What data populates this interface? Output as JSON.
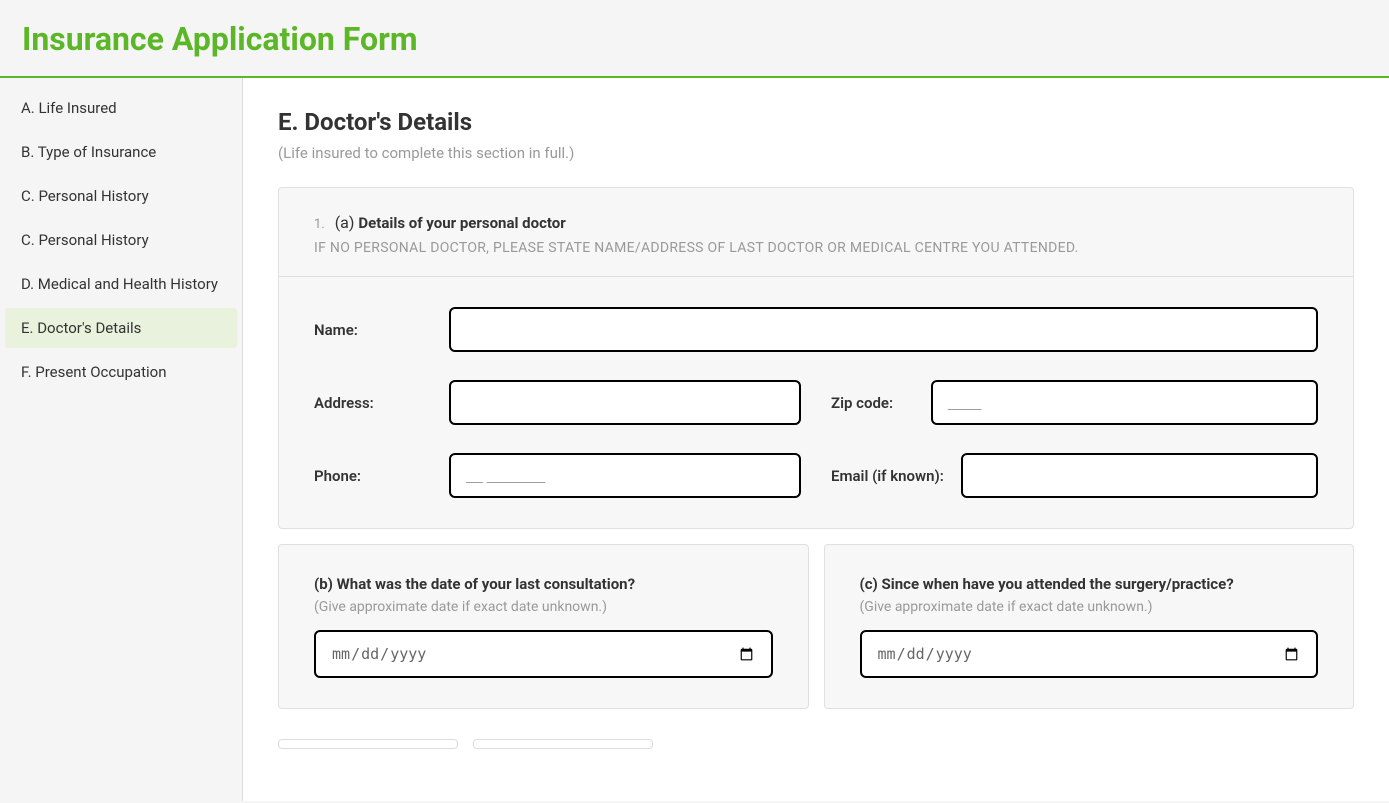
{
  "header": {
    "title": "Insurance Application Form"
  },
  "sidebar": {
    "items": [
      {
        "label": "A. Life Insured",
        "active": false
      },
      {
        "label": "B. Type of Insurance",
        "active": false
      },
      {
        "label": "C. Personal History",
        "active": false
      },
      {
        "label": "C. Personal History",
        "active": false
      },
      {
        "label": "D. Medical and Health History",
        "active": false
      },
      {
        "label": "E. Doctor's Details",
        "active": true
      },
      {
        "label": "F. Present Occupation",
        "active": false
      }
    ]
  },
  "main": {
    "section_title": "E. Doctor's Details",
    "section_subtitle": "(Life insured to complete this section in full.)",
    "q1": {
      "number": "1.",
      "prefix": "(a) ",
      "title": "Details of your personal doctor",
      "sub": "IF NO PERSONAL DOCTOR, PLEASE STATE NAME/ADDRESS OF LAST DOCTOR OR MEDICAL CENTRE YOU ATTENDED.",
      "fields": {
        "name_label": "Name:",
        "name_value": "",
        "address_label": "Address:",
        "address_value": "",
        "zip_label": "Zip code:",
        "zip_placeholder": "____",
        "zip_value": "",
        "phone_label": "Phone:",
        "phone_placeholder": "__ _______",
        "phone_value": "",
        "email_label": "Email (if known):",
        "email_value": ""
      }
    },
    "qb": {
      "title": "(b) What was the date of your last consultation?",
      "sub": "(Give approximate date if exact date unknown.)",
      "placeholder": "mm/dd/yyyy",
      "value": ""
    },
    "qc": {
      "title": "(c) Since when have you attended the surgery/practice?",
      "sub": "(Give approximate date if exact date unknown.)",
      "placeholder": "mm/dd/yyyy",
      "value": ""
    }
  }
}
